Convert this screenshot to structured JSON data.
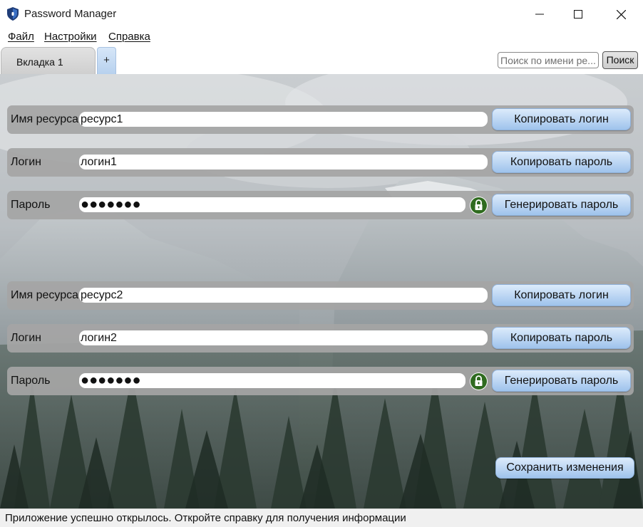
{
  "window": {
    "title": "Password Manager",
    "icon": "shield-icon"
  },
  "menu": {
    "file": "Файл",
    "settings": "Настройки",
    "help": "Справка"
  },
  "tabs": {
    "items": [
      {
        "label": "Вкладка 1"
      }
    ],
    "add_label": "+"
  },
  "search": {
    "placeholder": "Поиск по имени ре...",
    "button": "Поиск"
  },
  "entries": [
    {
      "resource_label": "Имя ресурса",
      "resource_value": "ресурс1",
      "copy_login_button": "Копировать логин",
      "login_label": "Логин",
      "login_value": "логин1",
      "copy_password_button": "Копировать пароль",
      "password_label": "Пароль",
      "password_value": "●●●●●●●",
      "generate_button": "Генерировать пароль",
      "lock_icon": "lock-icon"
    },
    {
      "resource_label": "Имя ресурса",
      "resource_value": "ресурс2",
      "copy_login_button": "Копировать логин",
      "login_label": "Логин",
      "login_value": "логин2",
      "copy_password_button": "Копировать пароль",
      "password_label": "Пароль",
      "password_value": "●●●●●●●",
      "generate_button": "Генерировать пароль",
      "lock_icon": "lock-icon"
    }
  ],
  "save_button": "Сохранить изменения",
  "status": {
    "text": "Приложение успешно открылось. Откройте справку для получения информации"
  },
  "colors": {
    "button_top": "#dcebfb",
    "button_bottom": "#9fc3ec",
    "row_background": "#a5a5a5",
    "lock_green": "#2f6b1f"
  }
}
